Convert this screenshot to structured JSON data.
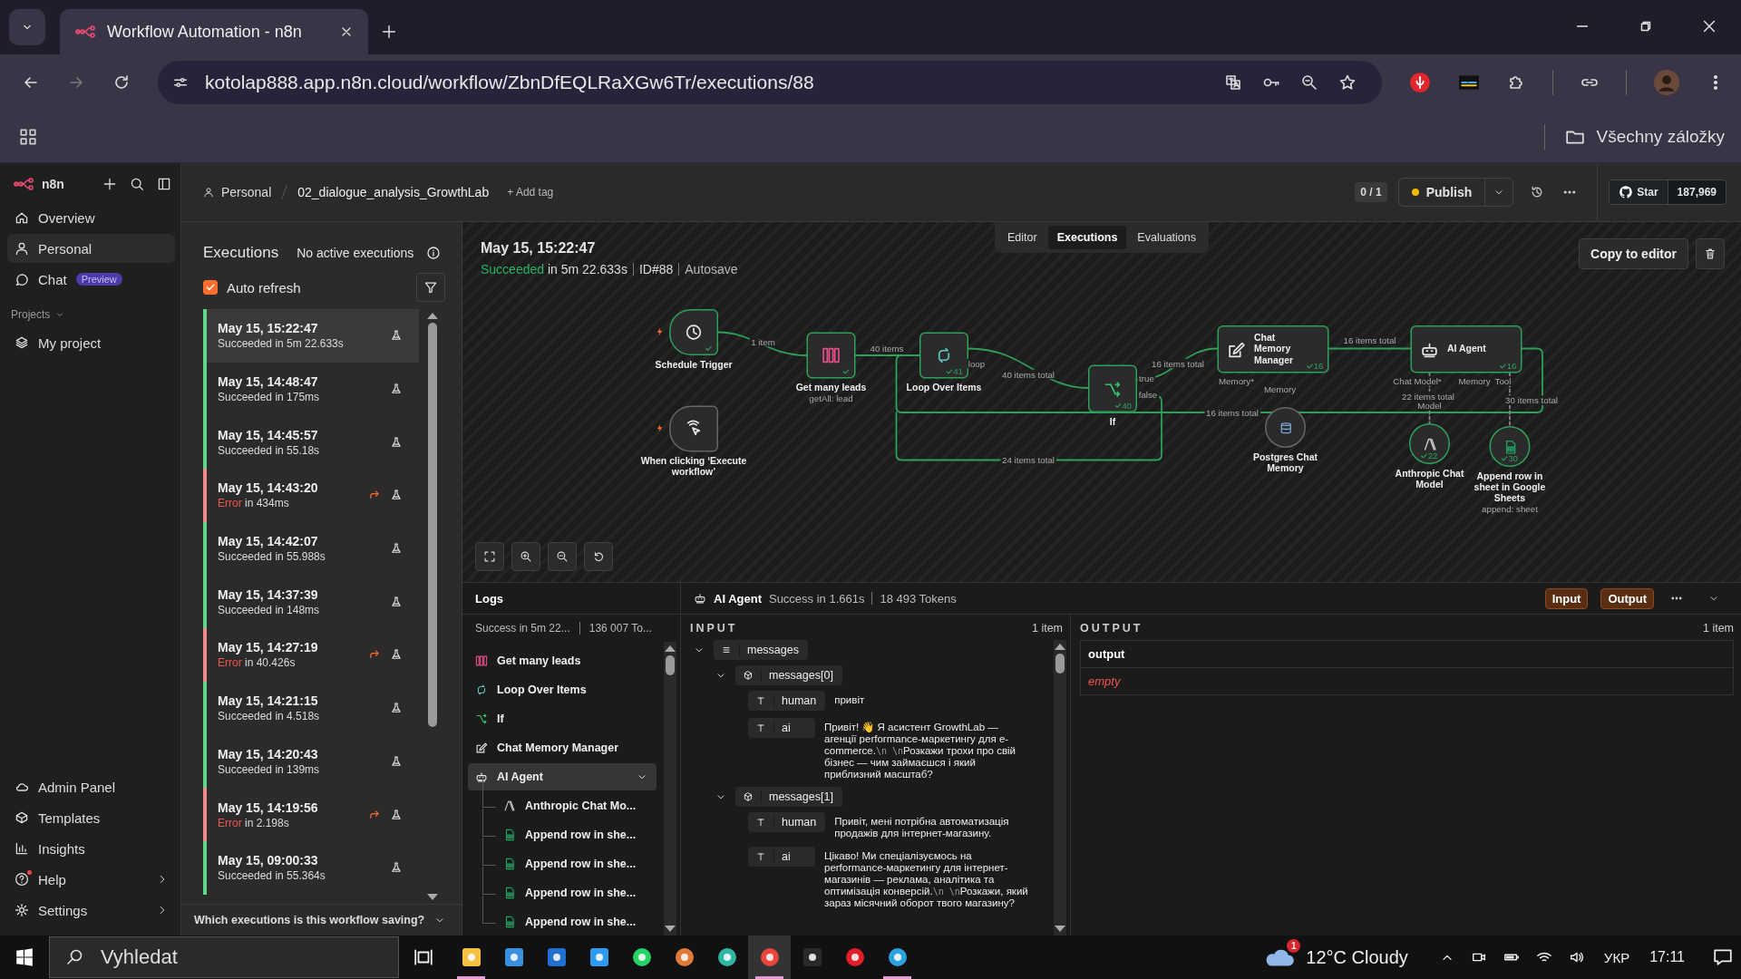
{
  "browser": {
    "tab_title": "Workflow Automation - n8n",
    "url": "kotolap888.app.n8n.cloud/workflow/ZbnDfEQLRaXGw6Tr/executions/88",
    "bookmarks_label": "Všechny záložky"
  },
  "sidebar": {
    "logo": "n8n",
    "items": [
      {
        "label": "Overview",
        "selected": false
      },
      {
        "label": "Personal",
        "selected": true
      },
      {
        "label": "Chat",
        "badge": "Preview",
        "selected": false
      }
    ],
    "projects_label": "Projects",
    "projects": [
      {
        "label": "My project",
        "selected": false
      }
    ],
    "bottom_items": [
      {
        "label": "Admin Panel",
        "chevron": false,
        "dot": false
      },
      {
        "label": "Templates",
        "chevron": false,
        "dot": false
      },
      {
        "label": "Insights",
        "chevron": false,
        "dot": false
      },
      {
        "label": "Help",
        "chevron": true,
        "dot": true
      },
      {
        "label": "Settings",
        "chevron": true,
        "dot": false
      }
    ]
  },
  "header": {
    "breadcrumb": [
      "Personal",
      "02_dialogue_analysis_GrowthLab"
    ],
    "add_tag": "+ Add tag",
    "counter": "0 / 1",
    "publish": "Publish",
    "star_label": "Star",
    "star_count": "187,969"
  },
  "tabs": [
    {
      "label": "Editor",
      "selected": false
    },
    {
      "label": "Executions",
      "selected": true
    },
    {
      "label": "Evaluations",
      "selected": false
    }
  ],
  "executions": {
    "title": "Executions",
    "status_text": "No active executions",
    "auto_refresh": {
      "label": "Auto refresh",
      "checked": true
    },
    "items": [
      {
        "time": "May 15, 15:22:47",
        "kind": "success",
        "status_label": "Succeeded",
        "duration": "in 5m 22.633s",
        "selected": true
      },
      {
        "time": "May 15, 14:48:47",
        "kind": "success",
        "status_label": "Succeeded",
        "duration": "in 175ms",
        "selected": false
      },
      {
        "time": "May 15, 14:45:57",
        "kind": "success",
        "status_label": "Succeeded",
        "duration": "in 55.18s",
        "selected": false
      },
      {
        "time": "May 15, 14:43:20",
        "kind": "error",
        "status_label": "Error",
        "duration": "in 434ms",
        "selected": false
      },
      {
        "time": "May 15, 14:42:07",
        "kind": "success",
        "status_label": "Succeeded",
        "duration": "in 55.988s",
        "selected": false
      },
      {
        "time": "May 15, 14:37:39",
        "kind": "success",
        "status_label": "Succeeded",
        "duration": "in 148ms",
        "selected": false
      },
      {
        "time": "May 15, 14:27:19",
        "kind": "error",
        "status_label": "Error",
        "duration": "in 40.426s",
        "selected": false
      },
      {
        "time": "May 15, 14:21:15",
        "kind": "success",
        "status_label": "Succeeded",
        "duration": "in 4.518s",
        "selected": false
      },
      {
        "time": "May 15, 14:20:43",
        "kind": "success",
        "status_label": "Succeeded",
        "duration": "in 139ms",
        "selected": false
      },
      {
        "time": "May 15, 14:19:56",
        "kind": "error",
        "status_label": "Error",
        "duration": "in 2.198s",
        "selected": false
      },
      {
        "time": "May 15, 09:00:33",
        "kind": "success",
        "status_label": "Succeeded",
        "duration": "in 55.364s",
        "selected": false
      }
    ],
    "footer": "Which executions is this workflow saving?"
  },
  "execution": {
    "time": "May 15, 15:22:47",
    "status_label": "Succeeded",
    "duration": "in 5m 22.633s",
    "id": "ID#88",
    "mode": "Autosave",
    "copy_button": "Copy to editor"
  },
  "diagram": {
    "nodes": [
      {
        "kind": "trigger",
        "label": "Schedule Trigger",
        "succeeded": true
      },
      {
        "kind": "manual",
        "label": "When clicking ‘Execute workflow’",
        "succeeded": false
      },
      {
        "kind": "leads",
        "label": "Get many leads",
        "sublabel": "getAll: lead",
        "succeeded": true
      },
      {
        "kind": "loop",
        "label": "Loop Over Items",
        "count": "41",
        "succeeded": true
      },
      {
        "kind": "branch",
        "label": "If",
        "count": "40",
        "succeeded": true
      },
      {
        "kind": "memory_manager",
        "label": "Chat Memory Manager",
        "count": "16",
        "succeeded": true
      },
      {
        "kind": "agent",
        "label": "AI Agent",
        "count": "16",
        "succeeded": true
      },
      {
        "kind": "memory",
        "label": "Postgres Chat Memory",
        "succeeded": false
      },
      {
        "kind": "model",
        "label": "Anthropic Chat Model",
        "count": "22",
        "succeeded": true
      },
      {
        "kind": "sheet",
        "label": "Append row in sheet in Google Sheets",
        "sublabel": "append: sheet",
        "count": "30",
        "succeeded": true
      }
    ],
    "edge_labels": [
      "1 item",
      "40 items",
      "40 items total",
      "16 items total",
      "16 items total",
      "16 items total",
      "24 items total",
      "22 items total",
      "30 items total"
    ],
    "port_labels": [
      "loop",
      "true",
      "false",
      "Memory*",
      "Memory",
      "Chat Model*",
      "Memory",
      "Tool",
      "Model"
    ]
  },
  "logs": {
    "title": "Logs",
    "summary": "Success in 5m 22...",
    "tokens": "136 007 To...",
    "items": [
      {
        "kind": "leads",
        "label": "Get many leads",
        "selected": false
      },
      {
        "kind": "loop",
        "label": "Loop Over Items",
        "selected": false
      },
      {
        "kind": "branch",
        "label": "If",
        "selected": false
      },
      {
        "kind": "memory_manager",
        "label": "Chat Memory Manager",
        "selected": false
      },
      {
        "kind": "agent",
        "label": "AI Agent",
        "selected": true,
        "expanded": true,
        "children": [
          {
            "kind": "model",
            "label": "Anthropic Chat Mo..."
          },
          {
            "kind": "sheet",
            "label": "Append row in she..."
          },
          {
            "kind": "sheet",
            "label": "Append row in she..."
          },
          {
            "kind": "sheet",
            "label": "Append row in she..."
          },
          {
            "kind": "sheet",
            "label": "Append row in she..."
          }
        ]
      }
    ]
  },
  "run": {
    "node": "AI Agent",
    "status": "Success in 1.661s",
    "tokens": "18 493 Tokens",
    "input_button": "Input",
    "output_button": "Output"
  },
  "input": {
    "title": "INPUT",
    "count": "1 item",
    "tree": [
      {
        "key": "messages",
        "expanded": true,
        "children": [
          {
            "key": "messages[0]",
            "expanded": true,
            "fields": [
              {
                "key": "human",
                "value": [
                  {
                    "kind": "plain",
                    "text": "привіт"
                  }
                ]
              },
              {
                "key": "ai",
                "value": [
                  {
                    "kind": "plain",
                    "text": "Привіт! 👋 Я асистент GrowthLab — агенції performance-маркетингу для e-commerce."
                  },
                  {
                    "kind": "escape",
                    "text": "\\n \\n"
                  },
                  {
                    "kind": "plain",
                    "text": "Розкажи трохи про свій бізнес — чим займаєшся і який приблизний масштаб?"
                  }
                ]
              }
            ]
          },
          {
            "key": "messages[1]",
            "expanded": true,
            "fields": [
              {
                "key": "human",
                "value": [
                  {
                    "kind": "plain",
                    "text": "Привіт, мені потрібна автоматизація продажів для інтернет-магазину."
                  }
                ]
              },
              {
                "key": "ai",
                "value": [
                  {
                    "kind": "plain",
                    "text": "Цікаво! Ми спеціалізуємось на performance-маркетингу для інтернет-магазинів — реклама, аналітика та оптимізація конверсій."
                  },
                  {
                    "kind": "escape",
                    "text": "\\n \\n"
                  },
                  {
                    "kind": "plain",
                    "text": "Розкажи, який зараз місячний оборот твого магазину?"
                  }
                ]
              }
            ]
          }
        ]
      }
    ]
  },
  "output": {
    "title": "OUTPUT",
    "count": "1 item",
    "column": "output",
    "value": "empty"
  },
  "taskbar": {
    "search_placeholder": "Vyhledat",
    "weather": "12°C Cloudy",
    "weather_badge": "1",
    "language": "УКР",
    "time": "17:11",
    "apps": [
      {
        "running": true,
        "selected": false
      },
      {
        "running": false,
        "selected": false
      },
      {
        "running": false,
        "selected": false
      },
      {
        "running": false,
        "selected": false
      },
      {
        "running": false,
        "selected": false
      },
      {
        "running": false,
        "selected": false
      },
      {
        "running": false,
        "selected": false
      },
      {
        "running": true,
        "selected": true
      },
      {
        "running": false,
        "selected": false
      },
      {
        "running": false,
        "selected": false
      },
      {
        "running": true,
        "selected": false
      }
    ]
  }
}
